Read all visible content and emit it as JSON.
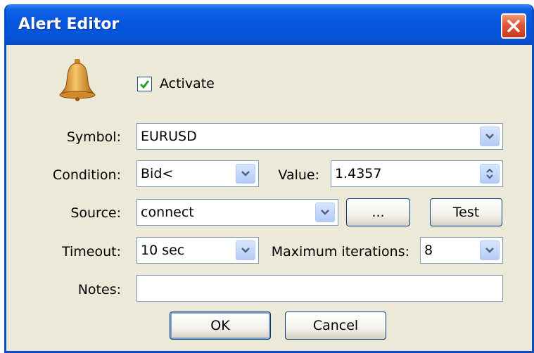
{
  "window": {
    "title": "Alert Editor"
  },
  "activate": {
    "label": "Activate",
    "checked": true
  },
  "symbol": {
    "label": "Symbol:",
    "value": "EURUSD"
  },
  "condition": {
    "label": "Condition:",
    "value": "Bid<"
  },
  "value": {
    "label": "Value:",
    "value": "1.4357"
  },
  "source": {
    "label": "Source:",
    "value": "connect",
    "browse_label": "...",
    "test_label": "Test"
  },
  "timeout": {
    "label": "Timeout:",
    "value": "10 sec"
  },
  "max_iterations": {
    "label": "Maximum iterations:",
    "value": "8"
  },
  "notes": {
    "label": "Notes:",
    "value": ""
  },
  "buttons": {
    "ok": "OK",
    "cancel": "Cancel"
  },
  "icons": {
    "bell": "bell-icon",
    "close": "close-icon",
    "dropdown": "chevron-down-icon",
    "spinner": "spin-arrows-icon"
  },
  "colors": {
    "titlebar": "#0553d8",
    "dialog_bg": "#ece9d8",
    "close_button": "#e0563a",
    "check_mark": "#21a121"
  }
}
